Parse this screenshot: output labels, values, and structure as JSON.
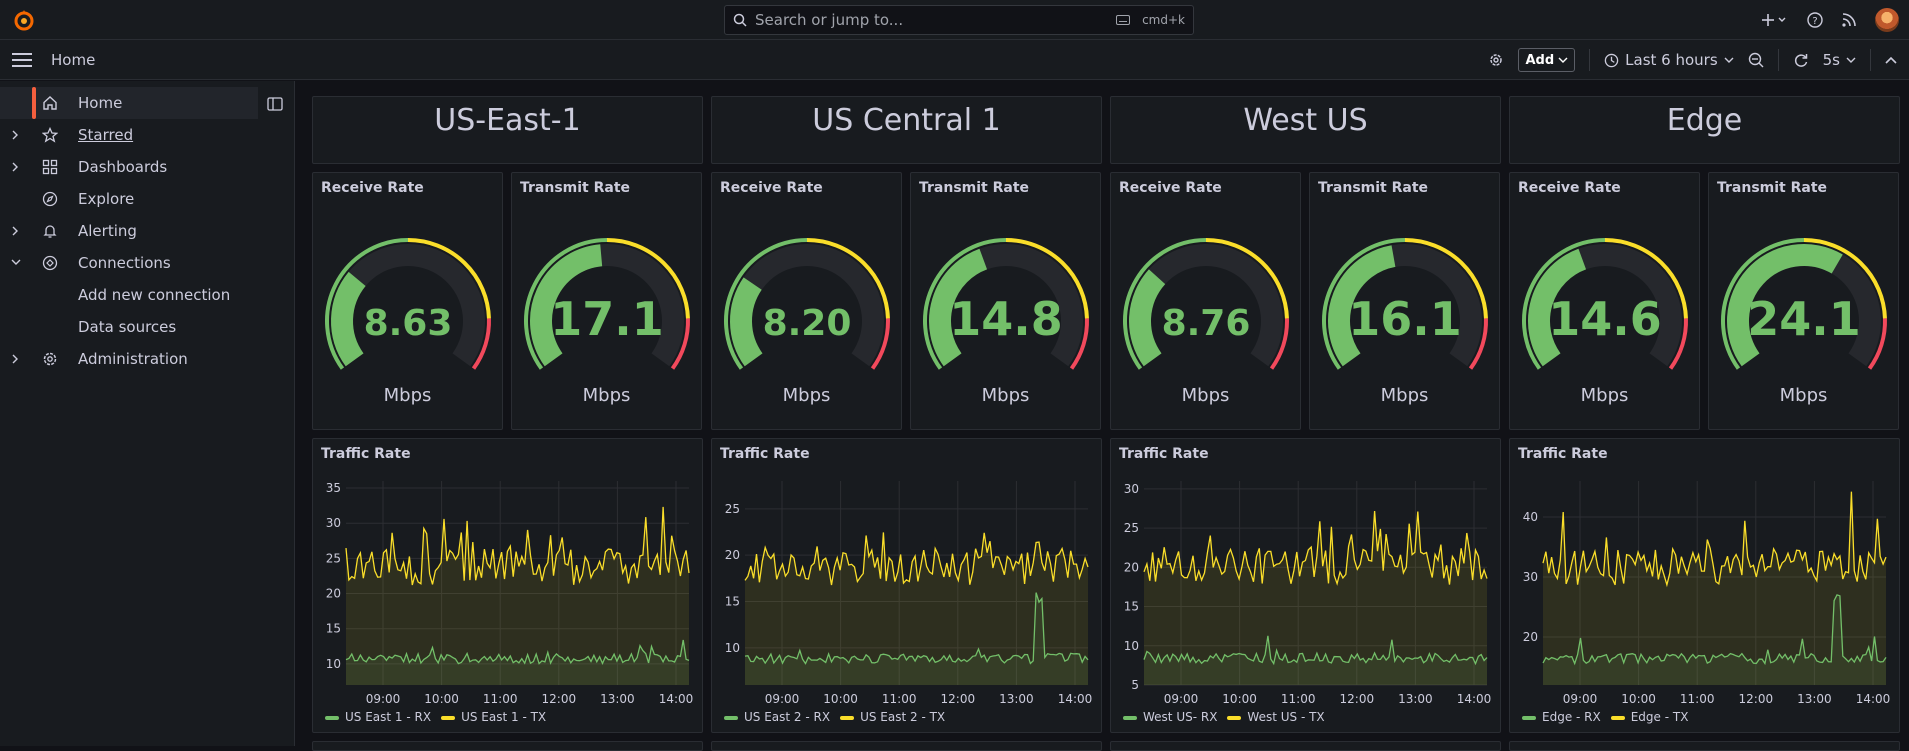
{
  "search": {
    "placeholder": "Search or jump to...",
    "shortcut": "cmd+k"
  },
  "breadcrumb": "Home",
  "toolbar": {
    "add_label": "Add",
    "time_range": "Last 6 hours",
    "refresh": "5s"
  },
  "sidebar": {
    "items": [
      {
        "label": "Home",
        "icon": "home-icon",
        "active": true,
        "chevron": false
      },
      {
        "label": "Starred",
        "icon": "star-icon",
        "chevron": true,
        "underline": true
      },
      {
        "label": "Dashboards",
        "icon": "grid-icon",
        "chevron": true
      },
      {
        "label": "Explore",
        "icon": "compass-icon",
        "chevron": false
      },
      {
        "label": "Alerting",
        "icon": "bell-icon",
        "chevron": true
      },
      {
        "label": "Connections",
        "icon": "connections-icon",
        "chevron": true,
        "expanded": true
      },
      {
        "label": "Add new connection",
        "sub": true
      },
      {
        "label": "Data sources",
        "sub": true
      },
      {
        "label": "Administration",
        "icon": "gear-icon",
        "chevron": true
      }
    ]
  },
  "regions": [
    {
      "title": "US-East-1",
      "rx": "8.63",
      "tx": "17.1",
      "rx_frac": 0.3,
      "tx_frac": 0.48,
      "legend_rx": "US East 1 - RX",
      "legend_tx": "US East 1 - TX",
      "y_ticks": [
        10,
        15,
        20,
        25,
        30,
        35
      ],
      "y_min": 7,
      "y_max": 36
    },
    {
      "title": "US Central 1",
      "rx": "8.20",
      "tx": "14.8",
      "rx_frac": 0.28,
      "tx_frac": 0.42,
      "legend_rx": "US East 2 - RX",
      "legend_tx": "US East 2 - TX",
      "y_ticks": [
        10,
        15,
        20,
        25
      ],
      "y_min": 6,
      "y_max": 28
    },
    {
      "title": "West US",
      "rx": "8.76",
      "tx": "16.1",
      "rx_frac": 0.31,
      "tx_frac": 0.46,
      "legend_rx": "West US- RX",
      "legend_tx": "West US - TX",
      "y_ticks": [
        5,
        10,
        15,
        20,
        25,
        30
      ],
      "y_min": 5,
      "y_max": 31
    },
    {
      "title": "Edge",
      "rx": "14.6",
      "tx": "24.1",
      "rx_frac": 0.42,
      "tx_frac": 0.62,
      "legend_rx": "Edge - RX",
      "legend_tx": "Edge - TX",
      "y_ticks": [
        20,
        30,
        40
      ],
      "y_min": 12,
      "y_max": 46
    }
  ],
  "labels": {
    "receive": "Receive Rate",
    "transmit": "Transmit Rate",
    "unit": "Mbps",
    "traffic": "Traffic Rate"
  },
  "x_ticks": [
    "09:00",
    "10:00",
    "11:00",
    "12:00",
    "13:00",
    "14:00"
  ],
  "colors": {
    "rx": "#73bf69",
    "tx": "#fade2a",
    "gauge_green": "#73bf69",
    "gauge_yellow": "#fade2a",
    "gauge_red": "#f2495c",
    "accent": "#f55f3e"
  }
}
